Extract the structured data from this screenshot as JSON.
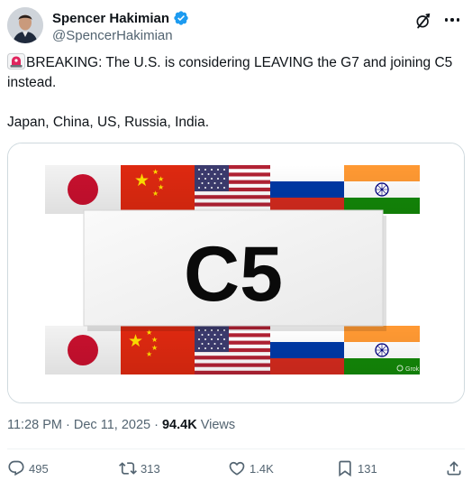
{
  "author": {
    "name": "Spencer Hakimian",
    "handle": "@SpencerHakimian",
    "verified": true
  },
  "tweet": {
    "line1": "BREAKING: The U.S. is considering LEAVING the G7 and joining C5 instead.",
    "line2": "Japan, China, US, Russia, India.",
    "emoji": "rotating-light"
  },
  "media": {
    "center_text": "C5",
    "watermark": "Grok",
    "flags": [
      "japan",
      "china",
      "united-states",
      "russia",
      "india"
    ]
  },
  "meta": {
    "time": "11:28 PM",
    "separator": " · ",
    "date": "Dec 11, 2025",
    "views_count": "94.4K",
    "views_label": " Views"
  },
  "actions": {
    "replies": "495",
    "reposts": "313",
    "likes": "1.4K",
    "bookmarks": "131"
  },
  "colors": {
    "text": "#0f1419",
    "secondary": "#536471",
    "verified": "#1d9bf0",
    "border": "#cfd9de"
  }
}
